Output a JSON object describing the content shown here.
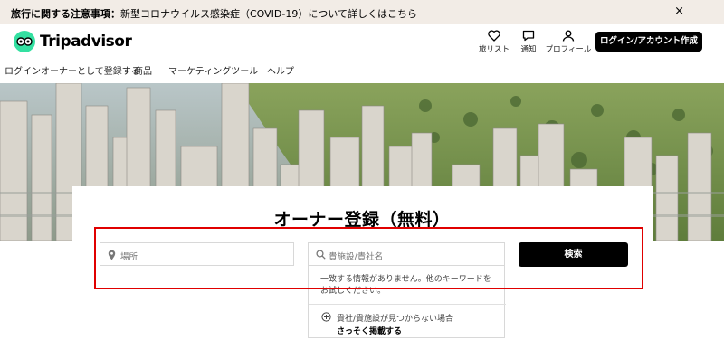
{
  "notice": {
    "label": "旅行に関する注意事項：",
    "text": "新型コロナウイルス感染症（COVID-19）について詳しくはこちら",
    "close": "×"
  },
  "header": {
    "brand": "Tripadvisor",
    "icons": [
      {
        "icon": "heart-icon",
        "label": "旅リスト"
      },
      {
        "icon": "message-icon",
        "label": "通知"
      },
      {
        "icon": "person-icon",
        "label": "プロフィール"
      }
    ],
    "login_button": "ログイン/アカウント作成"
  },
  "subnav": {
    "items": [
      "ログインオーナーとして登録する",
      "商品",
      "マーケティングツール",
      "ヘルプ"
    ]
  },
  "registration": {
    "title": "オーナー登録（無料）",
    "location_placeholder": "場所",
    "business_placeholder": "貴施設/貴社名",
    "search_button": "検索"
  },
  "dropdown": {
    "no_match": "一致する情報がありません。他のキーワードをお試しください。",
    "not_found": "貴社/貴施設が見つからない場合",
    "register_now": "さっそく掲載する"
  },
  "colors": {
    "brand_green": "#34e0a1",
    "highlight": "#e00000",
    "notice_bg": "#f2ece6"
  }
}
